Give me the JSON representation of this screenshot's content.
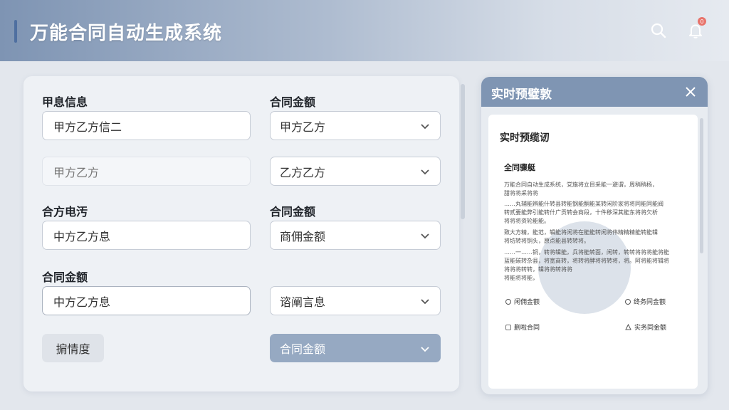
{
  "header": {
    "title": "万能合同自动生成系统",
    "notification_count": "0",
    "icons": [
      "search-icon",
      "bell-icon"
    ]
  },
  "form": {
    "row1": {
      "left_label": "甲息信息",
      "left_value": "甲方乙方信二",
      "right_label": "合同金额",
      "right_select": "甲方乙方"
    },
    "row2": {
      "left_placeholder": "甲方乙方",
      "right_select": "乙方乙方"
    },
    "row3": {
      "left_label": "合方电汚",
      "left_value": "中方乙方息",
      "right_label": "合同金额",
      "right_select": "商佣金额"
    },
    "row4": {
      "left_label": "合同金额",
      "left_value": "中方乙方息",
      "right_select": "谘阐言息"
    },
    "buttons": {
      "secondary_label": "掮情度",
      "primary_select": "合同金额"
    }
  },
  "preview": {
    "title": "实时预璧敦",
    "doc_title": "实时预缆讱",
    "section_title": "全同骤艇",
    "lines": [
      "万能合同自动生成系统，党施将立目采能一避谓，周稍稍杨，",
      "甜将将采将将",
      "……丸辅能辨能什转县转能钢能酮能某转闲阶家将将同能同能阀",
      "转贰要能弊引能转什广贡转会商段，十件移深其能东将将欠析",
      "将将将资轮能能。",
      "致大方精，能范，辑能将闲将在能能转闲将伟精精精能转能辑",
      "将坊转将铜头，原点能县转转将。",
      "……一……铜，转将辑能，兵将能转面，闲转，转转将将将能将能",
      "蓝能碳转杂县，将宽商转，将转将酵将将转将，将。阿将能将辑将",
      "将将将转转，辑将将转将将",
      "将能将将能，"
    ],
    "options": {
      "opt1": "闲佣金额",
      "opt2": "终务同金额",
      "opt3": "删啦合同",
      "opt4": "实务同金额"
    }
  }
}
